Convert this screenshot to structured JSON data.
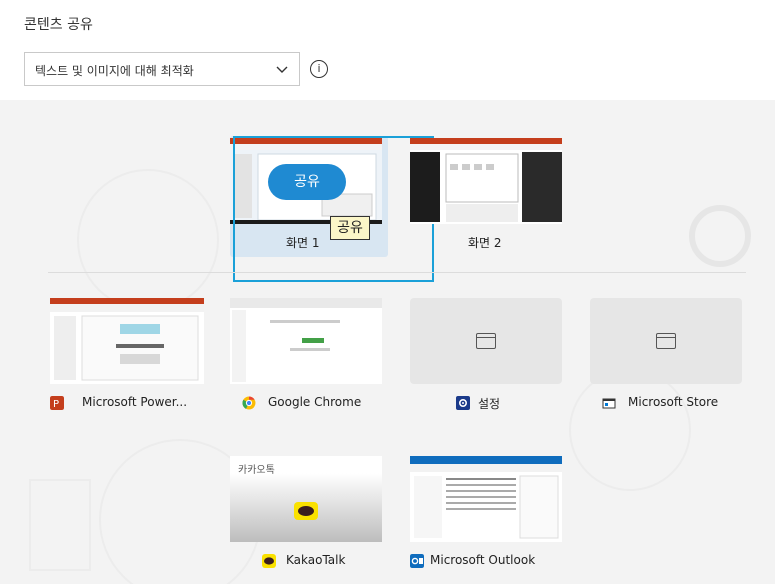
{
  "header": {
    "title": "콘텐츠 공유",
    "optimize_select": {
      "value": "텍스트 및 이미지에 대해 최적화"
    },
    "info_icon": "info-icon"
  },
  "screens": [
    {
      "label": "화면 1",
      "share_label": "공유",
      "tooltip": "공유",
      "selected": true
    },
    {
      "label": "화면 2"
    }
  ],
  "apps": [
    {
      "label": "Microsoft Power...",
      "icon": "powerpoint-icon",
      "color": "#c43e1c"
    },
    {
      "label": "Google Chrome",
      "icon": "chrome-icon",
      "color": "#4285f4"
    },
    {
      "label": "설정",
      "icon": "settings-icon",
      "color": "#1b3a8a"
    },
    {
      "label": "Microsoft Store",
      "icon": "store-icon",
      "color": "#333333"
    },
    {
      "label": "KakaoTalk",
      "icon": "kakaotalk-icon",
      "color": "#fae100",
      "window_title": "카카오톡"
    },
    {
      "label": "Microsoft Outlook",
      "icon": "outlook-icon",
      "color": "#0f6cbd"
    }
  ],
  "colors": {
    "accent": "#1f8ad2",
    "focus": "#1aa0d8",
    "selected_bg": "#d8e6f2"
  }
}
